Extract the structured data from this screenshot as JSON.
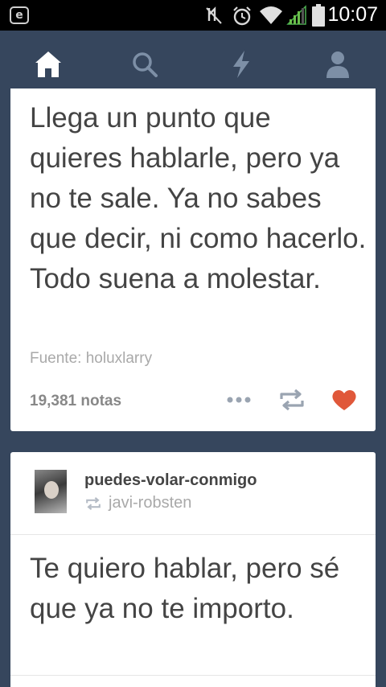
{
  "status_bar": {
    "time": "10:07",
    "left_icon_letter": "e",
    "icons": [
      "e-notification-icon",
      "mute-icon",
      "alarm-icon",
      "wifi-icon",
      "signal-icon",
      "battery-icon"
    ]
  },
  "nav": {
    "items": [
      {
        "name": "home",
        "icon": "home-icon",
        "active": true
      },
      {
        "name": "search",
        "icon": "search-icon",
        "active": false
      },
      {
        "name": "activity",
        "icon": "lightning-icon",
        "active": false
      },
      {
        "name": "account",
        "icon": "person-icon",
        "active": false
      }
    ]
  },
  "post1": {
    "quote": "Llega un punto que quieres hablarle, pero ya no te sale. Ya no sabes que decir, ni como hacerlo. Todo suena a molestar.",
    "source": "Fuente: holuxlarry",
    "notes": "19,381 notas",
    "actions": [
      "more-icon",
      "reblog-icon",
      "heart-icon"
    ],
    "liked": true
  },
  "post2": {
    "username": "puedes-volar-conmigo",
    "reblogged_from": "javi-robsten",
    "quote": "Te quiero hablar, pero sé que ya no te importo."
  },
  "colors": {
    "background": "#36465d",
    "text": "#444444",
    "muted": "#a9a9a9",
    "heart": "#e0583a"
  }
}
